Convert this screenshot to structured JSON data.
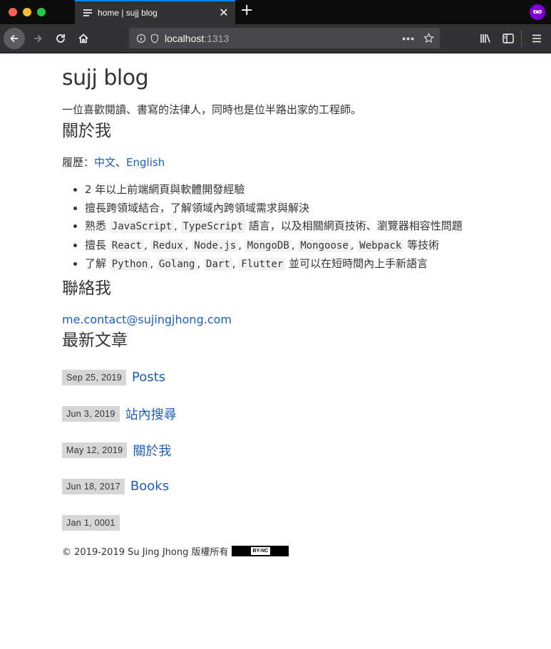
{
  "browser": {
    "tab_title": "home | sujj blog",
    "url_host": "localhost",
    "url_port": ":1313"
  },
  "site": {
    "title": "sujj blog",
    "tagline": "一位喜歡閱讀、書寫的法律人，同時也是位半路出家的工程師。"
  },
  "about": {
    "heading": "關於我",
    "resume_label": "履歷：",
    "resume_zh": "中文",
    "resume_sep": "、",
    "resume_en": "English",
    "skills": [
      {
        "text": "2 年以上前端網頁與軟體開發經驗"
      },
      {
        "text": "擅長跨領域結合，了解領域內跨領域需求與解決"
      }
    ],
    "skill_js": {
      "prefix": "熟悉 ",
      "codes": [
        "JavaScript",
        "TypeScript"
      ],
      "suffix": " 語言，以及相關網頁技術、瀏覽器相容性問題"
    },
    "skill_react": {
      "prefix": "擅長 ",
      "codes": [
        "React",
        "Redux",
        "Node.js",
        "MongoDB",
        "Mongoose",
        "Webpack"
      ],
      "suffix": " 等技術"
    },
    "skill_lang": {
      "prefix": "了解 ",
      "codes": [
        "Python",
        "Golang",
        "Dart",
        "Flutter"
      ],
      "suffix": " 並可以在短時間內上手新語言"
    }
  },
  "contact": {
    "heading": "聯絡我",
    "email": "me.contact@sujingjhong.com"
  },
  "latest": {
    "heading": "最新文章",
    "posts": [
      {
        "date": "Sep 25, 2019",
        "title": "Posts"
      },
      {
        "date": "Jun 3, 2019",
        "title": "站內搜尋"
      },
      {
        "date": "May 12, 2019",
        "title": "關於我"
      },
      {
        "date": "Jun 18, 2017",
        "title": "Books"
      },
      {
        "date": "Jan 1, 0001",
        "title": ""
      }
    ]
  },
  "footer": {
    "copyright": "© 2019-2019 Su Jing Jhong 版權所有",
    "license_badge": "BY-NC"
  },
  "colors": {
    "link": "#1b5fba",
    "date_bg": "#d6d6d6",
    "tab_accent": "#0a84ff"
  }
}
